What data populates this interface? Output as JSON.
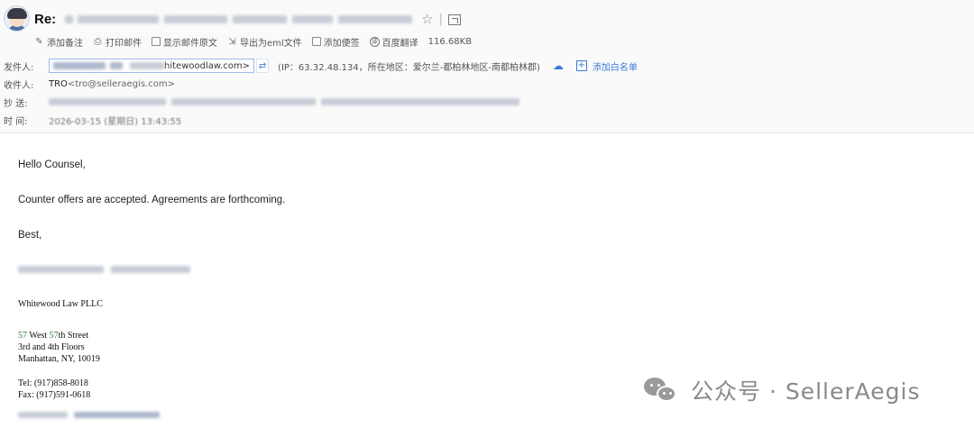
{
  "subject": {
    "prefix": "Re:"
  },
  "toolbar": {
    "items": [
      {
        "label": "添加备注",
        "icon": "pencil-icon"
      },
      {
        "label": "打印邮件",
        "icon": "printer-icon"
      },
      {
        "label": "显示邮件原文",
        "icon": "source-icon"
      },
      {
        "label": "导出为eml文件",
        "icon": "export-icon"
      },
      {
        "label": "添加便签",
        "icon": "note-icon"
      },
      {
        "label": "百度翻译",
        "icon": "translate-icon"
      }
    ],
    "size": "116.68KB"
  },
  "headers": {
    "from_label": "发件人:",
    "from_email_tail": "hitewoodlaw.com>",
    "ip_info": "(IP：63.32.48.134，所在地区：爱尔兰-都柏林地区-南都柏林郡)",
    "add_whitelist": "添加白名单",
    "to_label": "收件人:",
    "to_name": "TRO",
    "to_addr": "<tro@selleraegis.com>",
    "cc_label": "抄  送:",
    "time_label": "时  间:",
    "time_value": "2026-03-15 (星期日) 13:43:55"
  },
  "body": {
    "greeting": "Hello Counsel,",
    "line1": "Counter offers are accepted. Agreements are forthcoming.",
    "closing": "Best,"
  },
  "signature": {
    "firm": "Whitewood Law PLLC",
    "addr1_num1": "57",
    "addr1_mid": " West ",
    "addr1_num2": "57",
    "addr1_rest": "th Street",
    "addr2": "3rd and 4th Floors",
    "addr3": "Manhattan, NY, 10019",
    "tel": "Tel: (917)858-8018",
    "fax": "Fax: (917)591-0618"
  },
  "watermark": {
    "text": "公众号 · SellerAegis"
  },
  "colors": {
    "link_blue": "#3b78d8",
    "address_green": "#2e7d32"
  }
}
